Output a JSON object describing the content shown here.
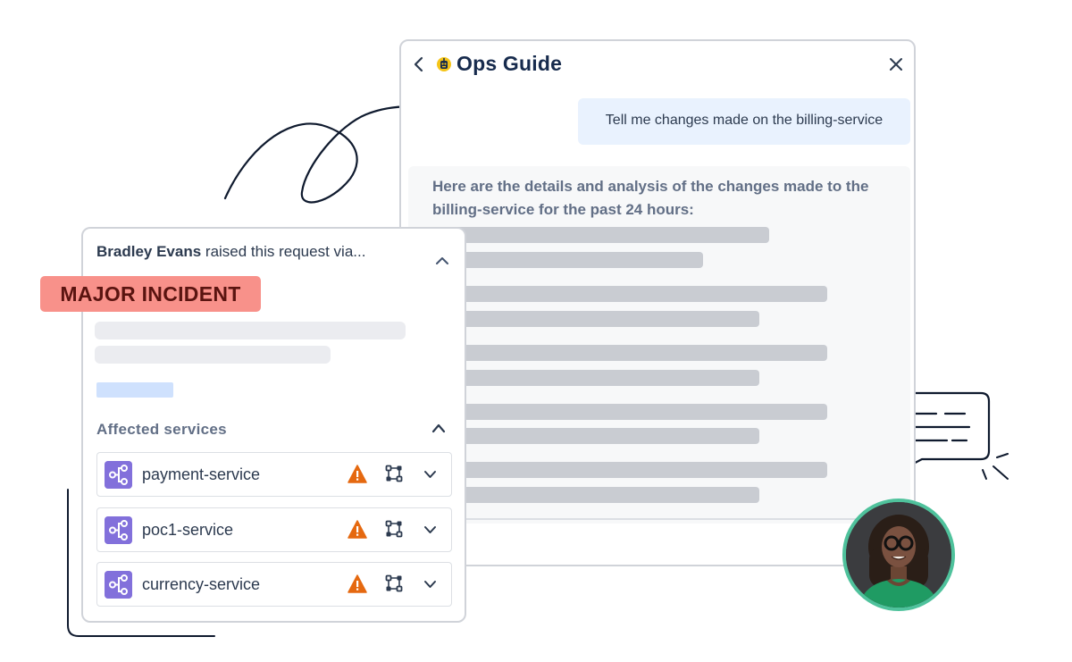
{
  "ops_guide": {
    "title": "Ops Guide",
    "user_message": "Tell me changes made on the billing-service",
    "bot_message": "Here are the details and analysis of the changes made to the billing-service for the past 24 hours:"
  },
  "request": {
    "requester_name": "Bradley Evans",
    "raised_text": " raised this request via...",
    "badge": "MAJOR INCIDENT",
    "affected_title": "Affected services",
    "services": [
      {
        "name": "payment-service"
      },
      {
        "name": "poc1-service"
      },
      {
        "name": "currency-service"
      }
    ]
  },
  "icons": {
    "back": "chevron-left-icon",
    "bot": "robot-icon",
    "close": "close-icon",
    "service": "service-node-icon",
    "warning": "warning-icon",
    "dependency": "dependency-graph-icon"
  },
  "colors": {
    "badge_bg": "#f8918a",
    "user_bubble": "#e9f2fe",
    "service_icon": "#8270db",
    "warning": "#e56910",
    "avatar_ring": "#4fc29c"
  }
}
